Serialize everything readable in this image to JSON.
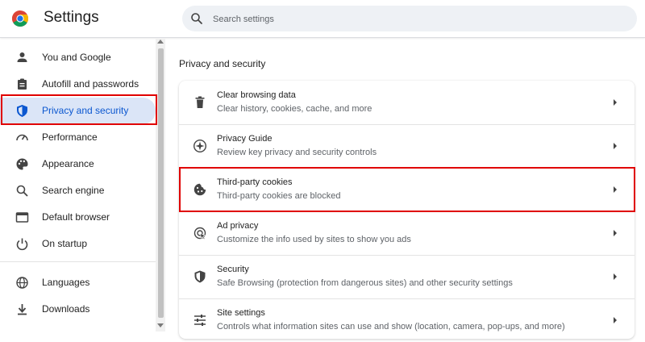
{
  "app": {
    "title": "Settings"
  },
  "search": {
    "placeholder": "Search settings",
    "value": ""
  },
  "sidebar": {
    "items": [
      {
        "label": "You and Google",
        "icon": "person-icon"
      },
      {
        "label": "Autofill and passwords",
        "icon": "clipboard-icon"
      },
      {
        "label": "Privacy and security",
        "icon": "shield-icon",
        "active": true
      },
      {
        "label": "Performance",
        "icon": "speedometer-icon"
      },
      {
        "label": "Appearance",
        "icon": "palette-icon"
      },
      {
        "label": "Search engine",
        "icon": "search-icon"
      },
      {
        "label": "Default browser",
        "icon": "browser-icon"
      },
      {
        "label": "On startup",
        "icon": "power-icon"
      },
      {
        "label": "Languages",
        "icon": "globe-icon"
      },
      {
        "label": "Downloads",
        "icon": "download-icon"
      }
    ]
  },
  "main": {
    "section_title": "Privacy and security",
    "rows": [
      {
        "title": "Clear browsing data",
        "subtitle": "Clear history, cookies, cache, and more",
        "icon": "trash-icon"
      },
      {
        "title": "Privacy Guide",
        "subtitle": "Review key privacy and security controls",
        "icon": "compass-icon"
      },
      {
        "title": "Third-party cookies",
        "subtitle": "Third-party cookies are blocked",
        "icon": "cookie-icon",
        "highlighted": true
      },
      {
        "title": "Ad privacy",
        "subtitle": "Customize the info used by sites to show you ads",
        "icon": "ad-privacy-icon"
      },
      {
        "title": "Security",
        "subtitle": "Safe Browsing (protection from dangerous sites) and other security settings",
        "icon": "security-shield-icon"
      },
      {
        "title": "Site settings",
        "subtitle": "Controls what information sites can use and show (location, camera, pop-ups, and more)",
        "icon": "sliders-icon"
      }
    ]
  },
  "colors": {
    "accent": "#0b57d0",
    "active_bg": "#dbe5f7",
    "highlight_box": "#e00000"
  }
}
